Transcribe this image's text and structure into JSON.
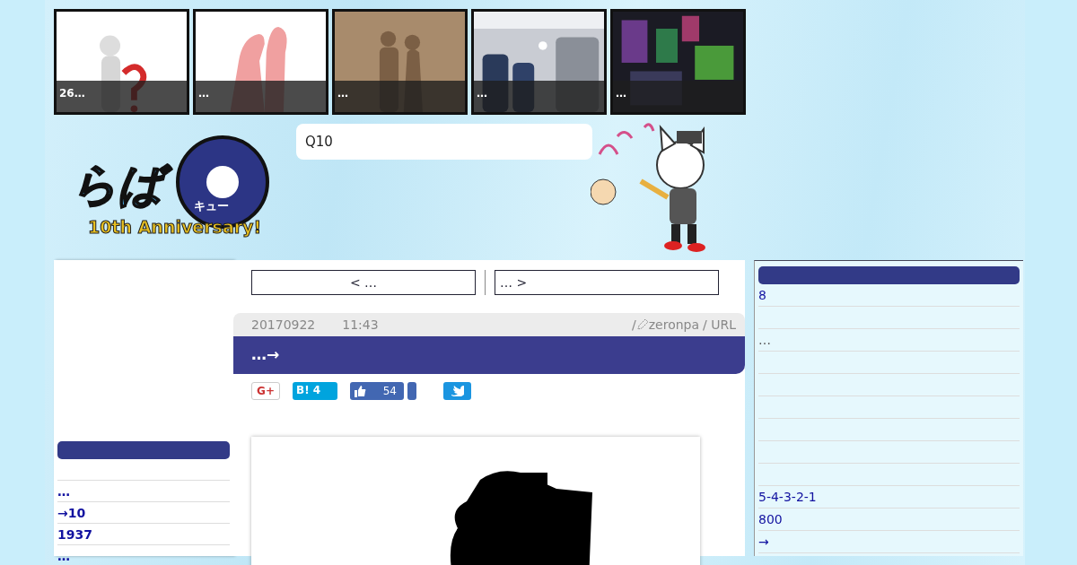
{
  "thumbnails": [
    {
      "caption": "26…"
    },
    {
      "caption": "…"
    },
    {
      "caption": "…"
    },
    {
      "caption": "…"
    },
    {
      "caption": "…"
    }
  ],
  "logo": {
    "main": "らば",
    "sub": "キュー",
    "anniversary": "10th Anniversary!"
  },
  "search": {
    "value": "Q10"
  },
  "post_nav": {
    "prev": "< …",
    "next": "… >"
  },
  "article": {
    "date": "20170922",
    "time": "11:43",
    "author_prefix": "/",
    "author": "zeronpa",
    "url_label": "/ URL",
    "title": "…→"
  },
  "share": [
    {
      "kind": "gplus",
      "label": "G+"
    },
    {
      "kind": "hatena",
      "label": "B!",
      "count": "4"
    },
    {
      "kind": "facebook",
      "count": "54"
    },
    {
      "kind": "twitter"
    }
  ],
  "left_sidebar": {
    "items": [
      {
        "kind": "blank"
      },
      {
        "kind": "link",
        "text": "…"
      },
      {
        "kind": "link",
        "text": "→10"
      },
      {
        "kind": "link",
        "text": "1937"
      },
      {
        "kind": "link",
        "text": "…"
      }
    ]
  },
  "right_sidebar": {
    "items": [
      {
        "kind": "link",
        "text": "8"
      },
      {
        "kind": "blank"
      },
      {
        "kind": "muted",
        "text": "…"
      },
      {
        "kind": "blank"
      },
      {
        "kind": "blank"
      },
      {
        "kind": "blank"
      },
      {
        "kind": "blank"
      },
      {
        "kind": "blank"
      },
      {
        "kind": "blank"
      },
      {
        "kind": "link",
        "text": "5-4-3-2-1"
      },
      {
        "kind": "link",
        "text": "800"
      },
      {
        "kind": "link",
        "text": "→"
      }
    ]
  }
}
